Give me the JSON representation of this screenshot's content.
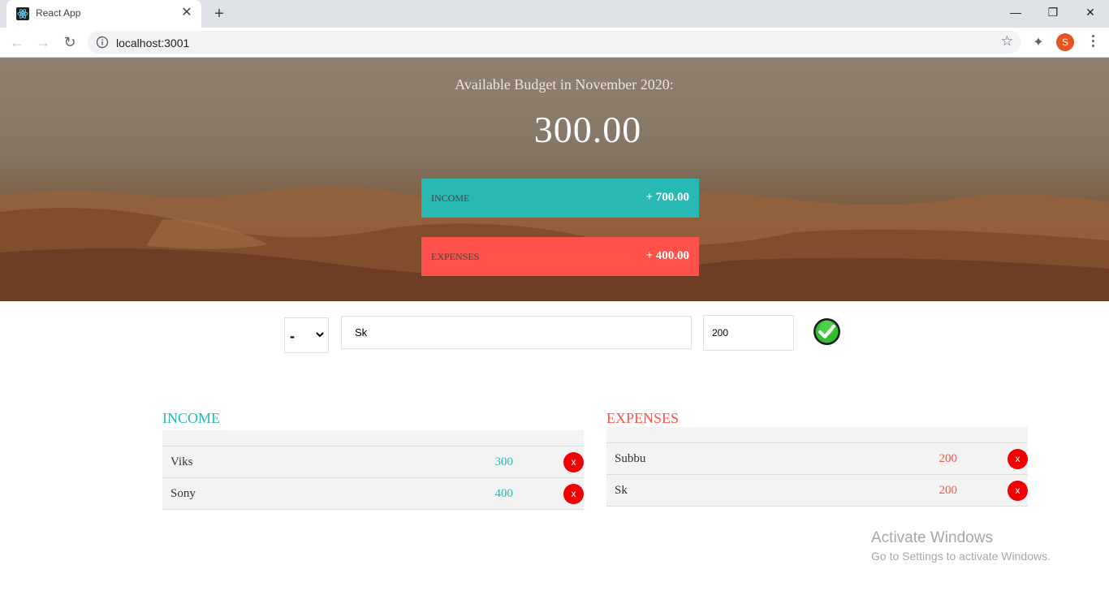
{
  "browser": {
    "tab_title": "React App",
    "url": "localhost:3001",
    "profile_initial": "S"
  },
  "budget": {
    "title": "Available Budget in November 2020:",
    "value": "300.00",
    "income_label": "INCOME",
    "income_value": "+ 700.00",
    "expenses_label": "EXPENSES",
    "expenses_value": "+ 400.00"
  },
  "form": {
    "type_selected": "-",
    "description_value": "Sk",
    "value_value": "200"
  },
  "income": {
    "title": "INCOME",
    "items": [
      {
        "description": "Viks",
        "value": "300"
      },
      {
        "description": "Sony",
        "value": "400"
      }
    ]
  },
  "expenses": {
    "title": "EXPENSES",
    "items": [
      {
        "description": "Subbu",
        "value": "200"
      },
      {
        "description": "Sk",
        "value": "200"
      }
    ]
  },
  "delete_label": "x",
  "watermark": {
    "line1": "Activate Windows",
    "line2": "Go to Settings to activate Windows."
  },
  "colors": {
    "income": "#28b9b5",
    "expenses": "#ff5049",
    "delete": "#f00000"
  },
  "icons": {
    "tab_favicon": "react-logo-icon",
    "add_button": "checkmark-circle-icon",
    "delete_button": "close-icon"
  }
}
